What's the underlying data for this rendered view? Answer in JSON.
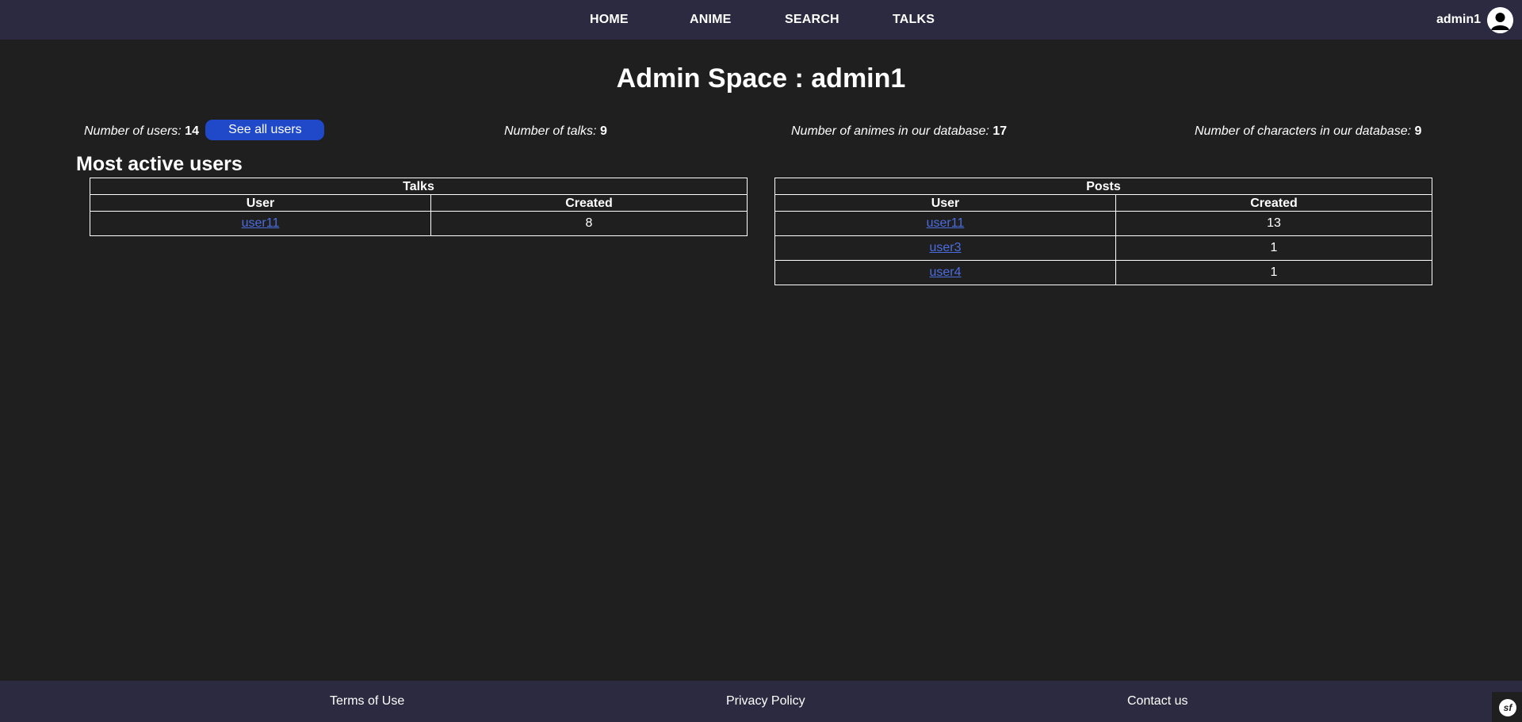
{
  "nav": {
    "links": [
      "HOME",
      "ANIME",
      "SEARCH",
      "TALKS"
    ],
    "username": "admin1"
  },
  "page": {
    "title": "Admin Space : admin1"
  },
  "stats": {
    "users_label": "Number of users:",
    "users_value": "14",
    "see_all_users": "See all users",
    "talks_label": "Number of talks:",
    "talks_value": "9",
    "animes_label": "Number of animes in our database:",
    "animes_value": "17",
    "characters_label": "Number of characters in our database:",
    "characters_value": "9"
  },
  "most_active": {
    "title": "Most active users",
    "talks_table": {
      "caption": "Talks",
      "columns": [
        "User",
        "Created"
      ],
      "rows": [
        {
          "user": "user11",
          "created": "8"
        }
      ]
    },
    "posts_table": {
      "caption": "Posts",
      "columns": [
        "User",
        "Created"
      ],
      "rows": [
        {
          "user": "user11",
          "created": "13"
        },
        {
          "user": "user3",
          "created": "1"
        },
        {
          "user": "user4",
          "created": "1"
        }
      ]
    }
  },
  "footer": {
    "links": [
      "Terms of Use",
      "Privacy Policy",
      "Contact us"
    ],
    "badge": "sf"
  }
}
